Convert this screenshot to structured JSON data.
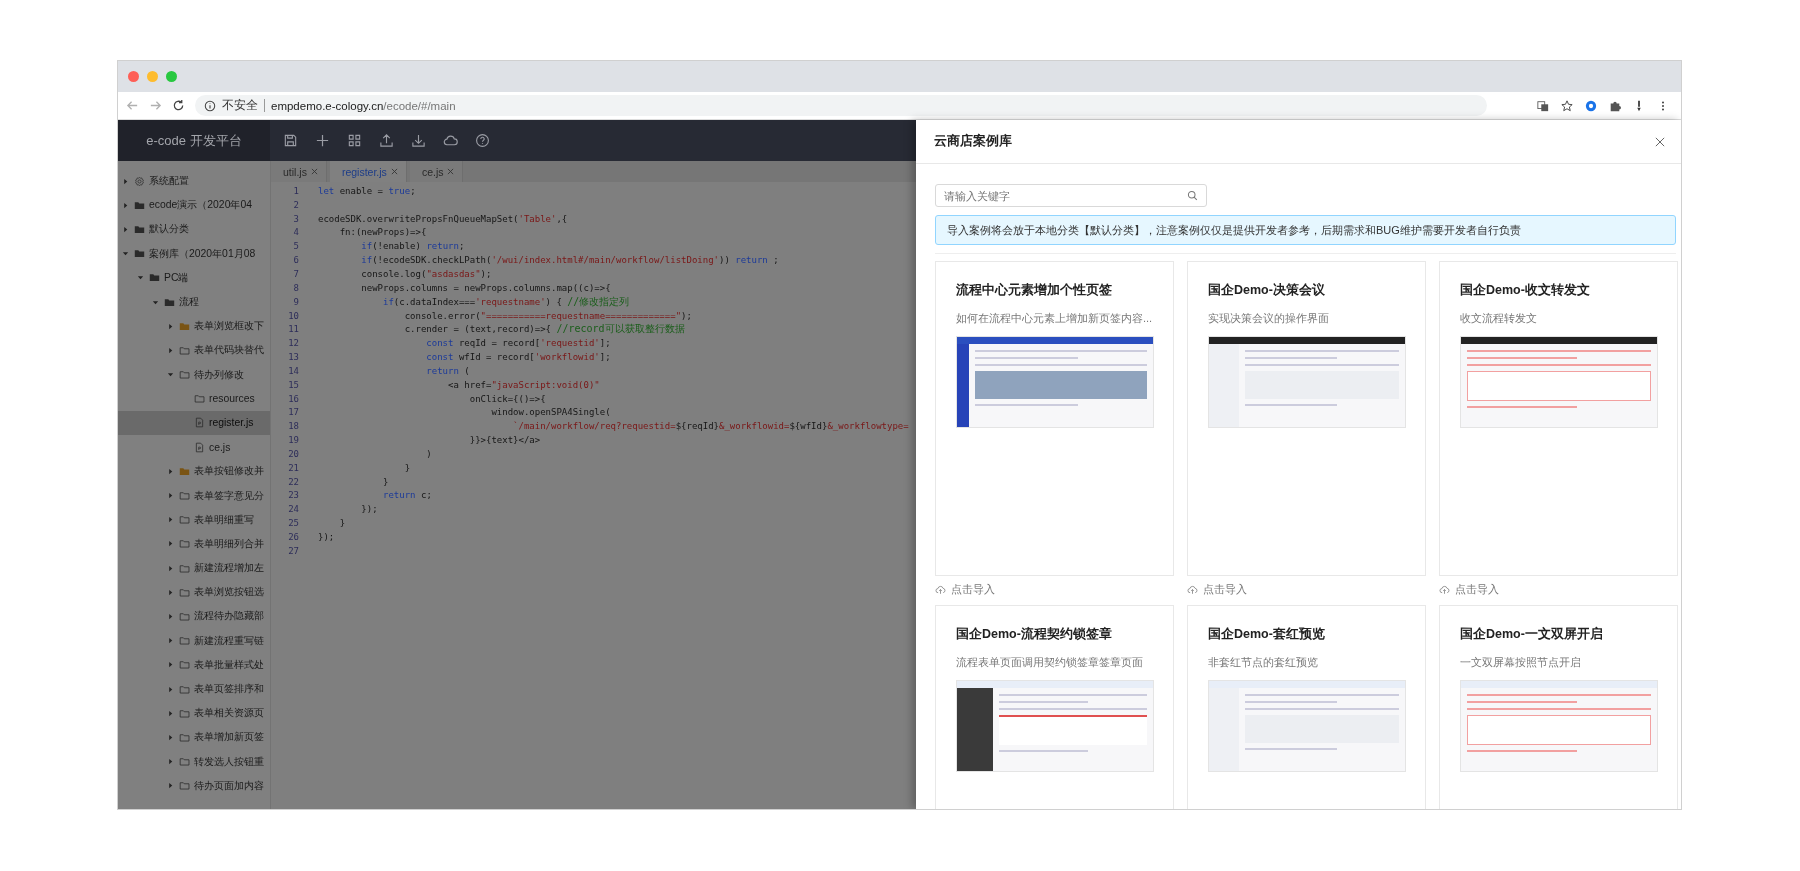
{
  "browser": {
    "security": "不安全",
    "url_host": "empdemo.e-cology.cn",
    "url_path": "/ecode/#/main"
  },
  "app": {
    "title": "e-code 开发平台"
  },
  "tree": [
    {
      "label": "系统配置",
      "kind": "settings",
      "expanded": false,
      "selected": false
    },
    {
      "label": "ecode演示（2020年04",
      "kind": "folder",
      "expanded": false,
      "selected": false
    },
    {
      "label": "默认分类",
      "kind": "folder",
      "expanded": false,
      "selected": false
    },
    {
      "label": "案例库（2020年01月08",
      "kind": "folder",
      "expanded": true,
      "selected": false,
      "children": [
        {
          "label": "PC端",
          "kind": "folder",
          "expanded": true,
          "selected": false,
          "children": [
            {
              "label": "流程",
              "kind": "folder",
              "expanded": true,
              "selected": false,
              "children": [
                {
                  "label": "表单浏览框改下",
                  "kind": "folder-marked",
                  "expanded": false,
                  "selected": false
                },
                {
                  "label": "表单代码块替代",
                  "kind": "folder-outline",
                  "expanded": false,
                  "selected": false
                },
                {
                  "label": "待办列修改",
                  "kind": "folder-outline",
                  "expanded": true,
                  "selected": false,
                  "children": [
                    {
                      "label": "resources",
                      "kind": "folder-outline",
                      "selected": false
                    },
                    {
                      "label": "register.js",
                      "kind": "file",
                      "selected": true
                    },
                    {
                      "label": "ce.js",
                      "kind": "file",
                      "selected": false
                    }
                  ]
                },
                {
                  "label": "表单按钮修改并",
                  "kind": "folder-marked",
                  "expanded": false,
                  "selected": false
                },
                {
                  "label": "表单签字意见分",
                  "kind": "folder-outline",
                  "expanded": false,
                  "selected": false
                },
                {
                  "label": "表单明细重写",
                  "kind": "folder-outline",
                  "expanded": false,
                  "selected": false
                },
                {
                  "label": "表单明细列合并",
                  "kind": "folder-outline",
                  "expanded": false,
                  "selected": false
                },
                {
                  "label": "新建流程增加左",
                  "kind": "folder-outline",
                  "expanded": false,
                  "selected": false
                },
                {
                  "label": "表单浏览按钮选",
                  "kind": "folder-outline",
                  "expanded": false,
                  "selected": false
                },
                {
                  "label": "流程待办隐藏部",
                  "kind": "folder-outline",
                  "expanded": false,
                  "selected": false
                },
                {
                  "label": "新建流程重写链",
                  "kind": "folder-outline",
                  "expanded": false,
                  "selected": false
                },
                {
                  "label": "表单批量样式处",
                  "kind": "folder-outline",
                  "expanded": false,
                  "selected": false
                },
                {
                  "label": "表单页签排序和",
                  "kind": "folder-outline",
                  "expanded": false,
                  "selected": false
                },
                {
                  "label": "表单相关资源页",
                  "kind": "folder-outline",
                  "expanded": false,
                  "selected": false
                },
                {
                  "label": "表单增加新页签",
                  "kind": "folder-outline",
                  "expanded": false,
                  "selected": false
                },
                {
                  "label": "转发选人按钮重",
                  "kind": "folder-outline",
                  "expanded": false,
                  "selected": false
                },
                {
                  "label": "待办页面加内容",
                  "kind": "folder-outline",
                  "expanded": false,
                  "selected": false
                }
              ]
            }
          ]
        }
      ]
    }
  ],
  "tabs": [
    {
      "label": "util.js",
      "selected": false
    },
    {
      "label": "register.js",
      "selected": true
    },
    {
      "label": "ce.js",
      "selected": false
    }
  ],
  "code": [
    {
      "n": "1",
      "code": [
        {
          "t": "let",
          "kind": "keyword"
        },
        {
          "t": " enable = ",
          "kind": "plain"
        },
        {
          "t": "true",
          "kind": "keyword"
        },
        {
          "t": ";",
          "kind": "plain"
        }
      ]
    },
    {
      "n": "2"
    },
    {
      "n": "3",
      "code": [
        {
          "t": "ecodeSDK.overwritePropsFnQueueMapSet(",
          "kind": "plain"
        },
        {
          "t": "'Table'",
          "kind": "string"
        },
        {
          "t": ",{",
          "kind": "plain"
        }
      ]
    },
    {
      "n": "4",
      "code": [
        {
          "t": "    fn:(newProps)=>{",
          "kind": "plain"
        }
      ]
    },
    {
      "n": "5",
      "code": [
        {
          "t": "        if",
          "kind": "keyword"
        },
        {
          "t": "(!enable) ",
          "kind": "plain"
        },
        {
          "t": "return",
          "kind": "keyword"
        },
        {
          "t": ";",
          "kind": "plain"
        }
      ]
    },
    {
      "n": "6",
      "code": [
        {
          "t": "        if",
          "kind": "keyword"
        },
        {
          "t": "(!ecodeSDK.checkLPath(",
          "kind": "plain"
        },
        {
          "t": "'/wui/index.html#/main/workflow/listDoing'",
          "kind": "string"
        },
        {
          "t": ")) ",
          "kind": "plain"
        },
        {
          "t": "return",
          "kind": "keyword"
        },
        {
          "t": " ;",
          "kind": "plain"
        }
      ]
    },
    {
      "n": "7",
      "code": [
        {
          "t": "        console.log(",
          "kind": "plain"
        },
        {
          "t": "\"asdasdas\"",
          "kind": "string"
        },
        {
          "t": ");",
          "kind": "plain"
        }
      ]
    },
    {
      "n": "8",
      "code": [
        {
          "t": "        newProps.columns = newProps.columns.map((c)=>{",
          "kind": "plain"
        }
      ]
    },
    {
      "n": "9",
      "code": [
        {
          "t": "            if",
          "kind": "keyword"
        },
        {
          "t": "(c.dataIndex===",
          "kind": "plain"
        },
        {
          "t": "'requestname'",
          "kind": "string"
        },
        {
          "t": ") { ",
          "kind": "plain"
        },
        {
          "t": "//修改指定列",
          "kind": "comment"
        }
      ]
    },
    {
      "n": "10",
      "code": [
        {
          "t": "                console.error(",
          "kind": "plain"
        },
        {
          "t": "\"===========requestname=============\"",
          "kind": "string"
        },
        {
          "t": ");",
          "kind": "plain"
        }
      ]
    },
    {
      "n": "11",
      "code": [
        {
          "t": "                c.render = (text,record)=>{ ",
          "kind": "plain"
        },
        {
          "t": "//record可以获取整行数据",
          "kind": "comment"
        }
      ]
    },
    {
      "n": "12",
      "code": [
        {
          "t": "                    const",
          "kind": "keyword"
        },
        {
          "t": " reqId = record[",
          "kind": "plain"
        },
        {
          "t": "'requestid'",
          "kind": "string"
        },
        {
          "t": "];",
          "kind": "plain"
        }
      ]
    },
    {
      "n": "13",
      "code": [
        {
          "t": "                    const",
          "kind": "keyword"
        },
        {
          "t": " wfId = record[",
          "kind": "plain"
        },
        {
          "t": "'workflowid'",
          "kind": "string"
        },
        {
          "t": "];",
          "kind": "plain"
        }
      ]
    },
    {
      "n": "14",
      "code": [
        {
          "t": "                    return",
          "kind": "keyword"
        },
        {
          "t": " (",
          "kind": "plain"
        }
      ]
    },
    {
      "n": "15",
      "code": [
        {
          "t": "                        <a href=",
          "kind": "plain"
        },
        {
          "t": "\"javaScript:void(0)\"",
          "kind": "string"
        }
      ]
    },
    {
      "n": "16",
      "code": [
        {
          "t": "                            onClick={()=>{",
          "kind": "plain"
        }
      ]
    },
    {
      "n": "17",
      "code": [
        {
          "t": "                                window.openSPA4Single(",
          "kind": "plain"
        }
      ]
    },
    {
      "n": "18",
      "code": [
        {
          "t": "                                    `/main/workflow/req?requestid=",
          "kind": "string"
        },
        {
          "t": "${reqId}",
          "kind": "plain"
        },
        {
          "t": "&_workflowid=",
          "kind": "string"
        },
        {
          "t": "${wfId}",
          "kind": "plain"
        },
        {
          "t": "&_workflowtype=",
          "kind": "string"
        }
      ]
    },
    {
      "n": "19",
      "code": [
        {
          "t": "                            }}>{text}</a>",
          "kind": "plain"
        }
      ]
    },
    {
      "n": "20",
      "code": [
        {
          "t": "                    )",
          "kind": "plain"
        }
      ]
    },
    {
      "n": "21",
      "code": [
        {
          "t": "                }",
          "kind": "plain"
        }
      ]
    },
    {
      "n": "22",
      "code": [
        {
          "t": "            }",
          "kind": "plain"
        }
      ]
    },
    {
      "n": "23",
      "code": [
        {
          "t": "            return",
          "kind": "keyword"
        },
        {
          "t": " c;",
          "kind": "plain"
        }
      ]
    },
    {
      "n": "24",
      "code": [
        {
          "t": "        });",
          "kind": "plain"
        }
      ]
    },
    {
      "n": "25",
      "code": [
        {
          "t": "    }",
          "kind": "plain"
        }
      ]
    },
    {
      "n": "26",
      "code": [
        {
          "t": "});",
          "kind": "plain"
        }
      ]
    },
    {
      "n": "27"
    }
  ],
  "drawer": {
    "title": "云商店案例库",
    "search": {
      "placeholder": "请输入关键字"
    },
    "notice": "导入案例将会放于本地分类【默认分类】，注意案例仅仅是提供开发者参考，后期需求和BUG维护需要开发者自行负责",
    "cards": [
      {
        "title": "流程中心元素增加个性页签",
        "description": "如何在流程中心元素上增加新页签内容...",
        "action": "点击导入"
      },
      {
        "title": "国企Demo-决策会议",
        "description": "实现决策会议的操作界面",
        "action": "点击导入"
      },
      {
        "title": "国企Demo-收文转发文",
        "description": "收文流程转发文",
        "action": "点击导入"
      },
      {
        "title": "国企Demo-流程契约锁签章",
        "description": "流程表单页面调用契约锁签章签章页面"
      },
      {
        "title": "国企Demo-套红预览",
        "description": "非套红节点的套红预览"
      },
      {
        "title": "国企Demo-一文双屏开启",
        "description": "一文双屏幕按照节点开启"
      }
    ]
  }
}
